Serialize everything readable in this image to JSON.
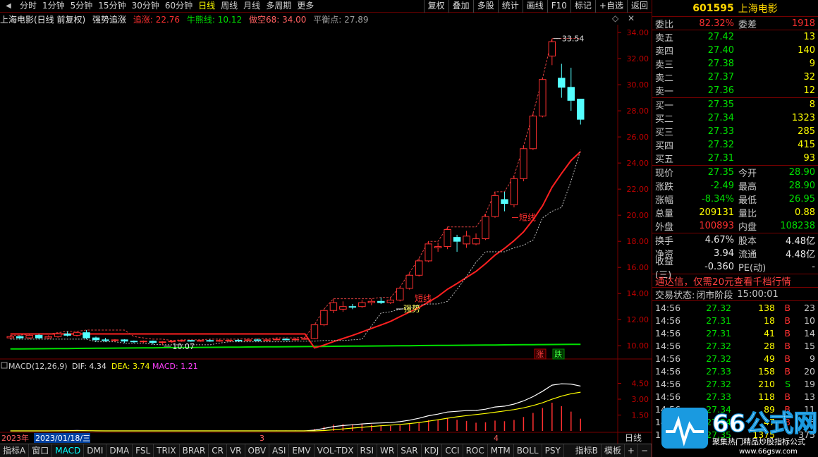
{
  "toolbar": {
    "periods": [
      "分时",
      "1分钟",
      "5分钟",
      "15分钟",
      "30分钟",
      "60分钟",
      "日线",
      "周线",
      "月线",
      "多周期",
      "更多"
    ],
    "active_period": "日线",
    "tools": [
      "复权",
      "叠加",
      "多股",
      "统计",
      "画线",
      "F10",
      "标记",
      "+自选",
      "返回"
    ]
  },
  "title_line": {
    "stock": "上海电影(日线 前复权)",
    "indicator": "强势追涨",
    "zhuizhang_label": "追涨: 22.76",
    "niuxian_label": "牛熊线: 10.12",
    "zuokong_label": "做空68: 34.00",
    "pingheng_label": "平衡点: 27.89"
  },
  "chart_data": {
    "type": "candlestick",
    "y_ticks": [
      "34.00",
      "32.00",
      "30.00",
      "28.00",
      "26.00",
      "24.00",
      "22.00",
      "20.00",
      "18.00",
      "16.00",
      "14.00",
      "12.00",
      "10.00"
    ],
    "ylim": [
      9.2,
      34.6
    ],
    "annotations": {
      "high": "33.54",
      "low": "10.07",
      "duanxian": "短线",
      "qiangshi": "强势",
      "zhang": "涨",
      "die": "跌"
    },
    "x_labels": [
      "2023年",
      "2023/01/18/三",
      "3",
      "4"
    ],
    "candles": [
      {
        "o": 10.6,
        "c": 10.7,
        "h": 10.8,
        "l": 10.5
      },
      {
        "o": 10.7,
        "c": 10.6,
        "h": 10.8,
        "l": 10.5
      },
      {
        "o": 10.6,
        "c": 10.8,
        "h": 10.9,
        "l": 10.5
      },
      {
        "o": 10.8,
        "c": 10.6,
        "h": 10.9,
        "l": 10.5
      },
      {
        "o": 10.6,
        "c": 10.7,
        "h": 10.8,
        "l": 10.5
      },
      {
        "o": 10.7,
        "c": 10.9,
        "h": 11.0,
        "l": 10.6
      },
      {
        "o": 10.9,
        "c": 10.8,
        "h": 11.1,
        "l": 10.7
      },
      {
        "o": 10.8,
        "c": 11.0,
        "h": 11.1,
        "l": 10.7
      },
      {
        "o": 11.0,
        "c": 10.6,
        "h": 11.2,
        "l": 10.5
      },
      {
        "o": 10.6,
        "c": 10.45,
        "h": 10.7,
        "l": 10.3
      },
      {
        "o": 10.45,
        "c": 10.4,
        "h": 10.6,
        "l": 10.3
      },
      {
        "o": 10.4,
        "c": 10.45,
        "h": 10.5,
        "l": 10.3
      },
      {
        "o": 10.45,
        "c": 10.35,
        "h": 10.5,
        "l": 10.2
      },
      {
        "o": 10.35,
        "c": 10.3,
        "h": 10.4,
        "l": 10.2
      },
      {
        "o": 10.3,
        "c": 10.35,
        "h": 10.4,
        "l": 10.2
      },
      {
        "o": 10.35,
        "c": 10.25,
        "h": 10.4,
        "l": 10.1
      },
      {
        "o": 10.25,
        "c": 10.3,
        "h": 10.35,
        "l": 10.07
      },
      {
        "o": 10.3,
        "c": 10.35,
        "h": 10.4,
        "l": 10.2
      },
      {
        "o": 10.35,
        "c": 10.4,
        "h": 10.45,
        "l": 10.3
      },
      {
        "o": 10.4,
        "c": 10.35,
        "h": 10.45,
        "l": 10.3
      },
      {
        "o": 10.35,
        "c": 10.4,
        "h": 10.45,
        "l": 10.3
      },
      {
        "o": 10.4,
        "c": 10.38,
        "h": 10.5,
        "l": 10.3
      },
      {
        "o": 10.38,
        "c": 10.4,
        "h": 10.5,
        "l": 10.3
      },
      {
        "o": 10.4,
        "c": 10.42,
        "h": 10.5,
        "l": 10.3
      },
      {
        "o": 10.42,
        "c": 10.4,
        "h": 10.5,
        "l": 10.3
      },
      {
        "o": 10.4,
        "c": 10.45,
        "h": 10.55,
        "l": 10.35
      },
      {
        "o": 10.45,
        "c": 10.42,
        "h": 10.55,
        "l": 10.35
      },
      {
        "o": 10.42,
        "c": 10.45,
        "h": 10.55,
        "l": 10.35
      },
      {
        "o": 10.45,
        "c": 10.5,
        "h": 10.6,
        "l": 10.4
      },
      {
        "o": 10.5,
        "c": 10.45,
        "h": 10.6,
        "l": 10.4
      },
      {
        "o": 10.45,
        "c": 10.5,
        "h": 10.6,
        "l": 10.4
      },
      {
        "o": 10.5,
        "c": 10.55,
        "h": 10.65,
        "l": 10.45
      },
      {
        "o": 10.55,
        "c": 11.6,
        "h": 11.6,
        "l": 10.5
      },
      {
        "o": 11.6,
        "c": 12.7,
        "h": 12.8,
        "l": 11.5
      },
      {
        "o": 12.7,
        "c": 13.3,
        "h": 13.6,
        "l": 12.5
      },
      {
        "o": 12.8,
        "c": 13.0,
        "h": 13.4,
        "l": 12.6
      },
      {
        "o": 13.0,
        "c": 12.95,
        "h": 13.2,
        "l": 12.8
      },
      {
        "o": 13.0,
        "c": 13.3,
        "h": 13.5,
        "l": 12.9
      },
      {
        "o": 13.3,
        "c": 13.4,
        "h": 13.6,
        "l": 13.1
      },
      {
        "o": 13.4,
        "c": 13.3,
        "h": 13.7,
        "l": 13.2
      },
      {
        "o": 13.3,
        "c": 13.5,
        "h": 13.7,
        "l": 13.2
      },
      {
        "o": 13.5,
        "c": 14.4,
        "h": 14.5,
        "l": 13.4
      },
      {
        "o": 14.4,
        "c": 15.4,
        "h": 15.6,
        "l": 14.3
      },
      {
        "o": 15.4,
        "c": 16.5,
        "h": 16.7,
        "l": 15.3
      },
      {
        "o": 16.5,
        "c": 17.8,
        "h": 18.0,
        "l": 16.4
      },
      {
        "o": 17.5,
        "c": 17.6,
        "h": 17.9,
        "l": 17.2
      },
      {
        "o": 17.6,
        "c": 18.9,
        "h": 19.1,
        "l": 17.4
      },
      {
        "o": 18.3,
        "c": 18.0,
        "h": 18.5,
        "l": 17.2
      },
      {
        "o": 17.8,
        "c": 18.4,
        "h": 18.8,
        "l": 17.5
      },
      {
        "o": 17.8,
        "c": 18.2,
        "h": 18.6,
        "l": 17.7
      },
      {
        "o": 18.2,
        "c": 19.9,
        "h": 20.1,
        "l": 18.1
      },
      {
        "o": 19.9,
        "c": 21.5,
        "h": 21.8,
        "l": 19.8
      },
      {
        "o": 21.2,
        "c": 20.9,
        "h": 21.8,
        "l": 20.3
      },
      {
        "o": 20.8,
        "c": 22.8,
        "h": 23.0,
        "l": 20.6
      },
      {
        "o": 22.8,
        "c": 25.1,
        "h": 25.3,
        "l": 22.6
      },
      {
        "o": 25.1,
        "c": 27.6,
        "h": 27.8,
        "l": 25.0
      },
      {
        "o": 27.6,
        "c": 30.4,
        "h": 30.5,
        "l": 27.5
      },
      {
        "o": 32.2,
        "c": 33.3,
        "h": 33.54,
        "l": 31.5
      },
      {
        "o": 30.5,
        "c": 29.8,
        "h": 31.6,
        "l": 29.0
      },
      {
        "o": 29.8,
        "c": 28.8,
        "h": 31.3,
        "l": 28.0
      },
      {
        "o": 28.9,
        "c": 27.35,
        "h": 28.9,
        "l": 26.95
      }
    ],
    "macd": {
      "label": "MACD(12,26,9)",
      "dif": "DIF: 4.34",
      "dea": "DEA: 3.74",
      "macd": "MACD: 1.21",
      "y_ticks": [
        "4.50",
        "3.00",
        "1.50"
      ],
      "ylim": [
        0,
        5.2
      ]
    }
  },
  "quote": {
    "code": "601595",
    "name": "上海电影",
    "weibi": {
      "label": "委比",
      "value": "82.32%",
      "label2": "委差",
      "value2": "1918"
    },
    "asks": [
      {
        "label": "卖五",
        "price": "27.42",
        "vol": "13"
      },
      {
        "label": "卖四",
        "price": "27.40",
        "vol": "140"
      },
      {
        "label": "卖三",
        "price": "27.38",
        "vol": "9"
      },
      {
        "label": "卖二",
        "price": "27.37",
        "vol": "32"
      },
      {
        "label": "卖一",
        "price": "27.36",
        "vol": "12"
      }
    ],
    "bids": [
      {
        "label": "买一",
        "price": "27.35",
        "vol": "8"
      },
      {
        "label": "买二",
        "price": "27.34",
        "vol": "1323"
      },
      {
        "label": "买三",
        "price": "27.33",
        "vol": "285"
      },
      {
        "label": "买四",
        "price": "27.32",
        "vol": "415"
      },
      {
        "label": "买五",
        "price": "27.31",
        "vol": "93"
      }
    ],
    "stats": [
      {
        "l1": "现价",
        "v1": "27.35",
        "c1": "g",
        "l2": "今开",
        "v2": "28.90",
        "c2": "g"
      },
      {
        "l1": "涨跌",
        "v1": "-2.49",
        "c1": "g",
        "l2": "最高",
        "v2": "28.90",
        "c2": "g"
      },
      {
        "l1": "涨幅",
        "v1": "-8.34%",
        "c1": "g",
        "l2": "最低",
        "v2": "26.95",
        "c2": "g"
      },
      {
        "l1": "总量",
        "v1": "209131",
        "c1": "y",
        "l2": "量比",
        "v2": "0.88",
        "c2": "y"
      },
      {
        "l1": "外盘",
        "v1": "100893",
        "c1": "r",
        "l2": "内盘",
        "v2": "108238",
        "c2": "g"
      }
    ],
    "stats2": [
      {
        "l1": "换手",
        "v1": "4.67%",
        "c1": "w",
        "l2": "股本",
        "v2": "4.48亿",
        "c2": "w"
      },
      {
        "l1": "净资",
        "v1": "3.94",
        "c1": "w",
        "l2": "流通",
        "v2": "4.48亿",
        "c2": "w"
      },
      {
        "l1": "收益(三)",
        "v1": "-0.360",
        "c1": "w",
        "l2": "PE(动)",
        "v2": "-",
        "c2": "w"
      }
    ],
    "promo": "通达信，仅需20元查看千档行情",
    "trade_status_label": "交易状态:",
    "trade_status": "闭市阶段",
    "trade_time": "15:00:01",
    "ticks": [
      {
        "t": "14:56",
        "p": "27.32",
        "q": "138",
        "bs": "B",
        "n": "23"
      },
      {
        "t": "14:56",
        "p": "27.31",
        "q": "18",
        "bs": "B",
        "n": "10"
      },
      {
        "t": "14:56",
        "p": "27.31",
        "q": "41",
        "bs": "B",
        "n": "14"
      },
      {
        "t": "14:56",
        "p": "27.32",
        "q": "28",
        "bs": "B",
        "n": "15"
      },
      {
        "t": "14:56",
        "p": "27.32",
        "q": "49",
        "bs": "B",
        "n": "9"
      },
      {
        "t": "14:56",
        "p": "27.33",
        "q": "158",
        "bs": "B",
        "n": "20"
      },
      {
        "t": "14:56",
        "p": "27.32",
        "q": "210",
        "bs": "S",
        "n": "19"
      },
      {
        "t": "14:56",
        "p": "27.33",
        "q": "118",
        "bs": "B",
        "n": "13"
      },
      {
        "t": "14:56",
        "p": "27.34",
        "q": "89",
        "bs": "B",
        "n": "11"
      },
      {
        "t": "14:56",
        "p": "27.34",
        "q": "47",
        "bs": "B",
        "n": "6"
      },
      {
        "t": "15:00",
        "p": "27.35",
        "q": "1375",
        "bs": "",
        "n": "375"
      }
    ]
  },
  "bottom_bar": {
    "items": [
      "指标A",
      "窗口",
      "MACD",
      "DMI",
      "DMA",
      "FSL",
      "TRIX",
      "BRAR",
      "CR",
      "VR",
      "OBV",
      "ASI",
      "EMV",
      "VOL-TDX",
      "RSI",
      "WR",
      "SAR",
      "KDJ",
      "CCI",
      "ROC",
      "MTM",
      "BOLL",
      "PSY"
    ],
    "active": "MACD",
    "right_items": [
      "指标B",
      "模板",
      "+",
      "−"
    ],
    "rightlabel": "日线"
  },
  "watermark": {
    "brand": "66公式网",
    "sub": "聚集热门精品炒股指标公式",
    "url": "www.66gsw.com"
  }
}
